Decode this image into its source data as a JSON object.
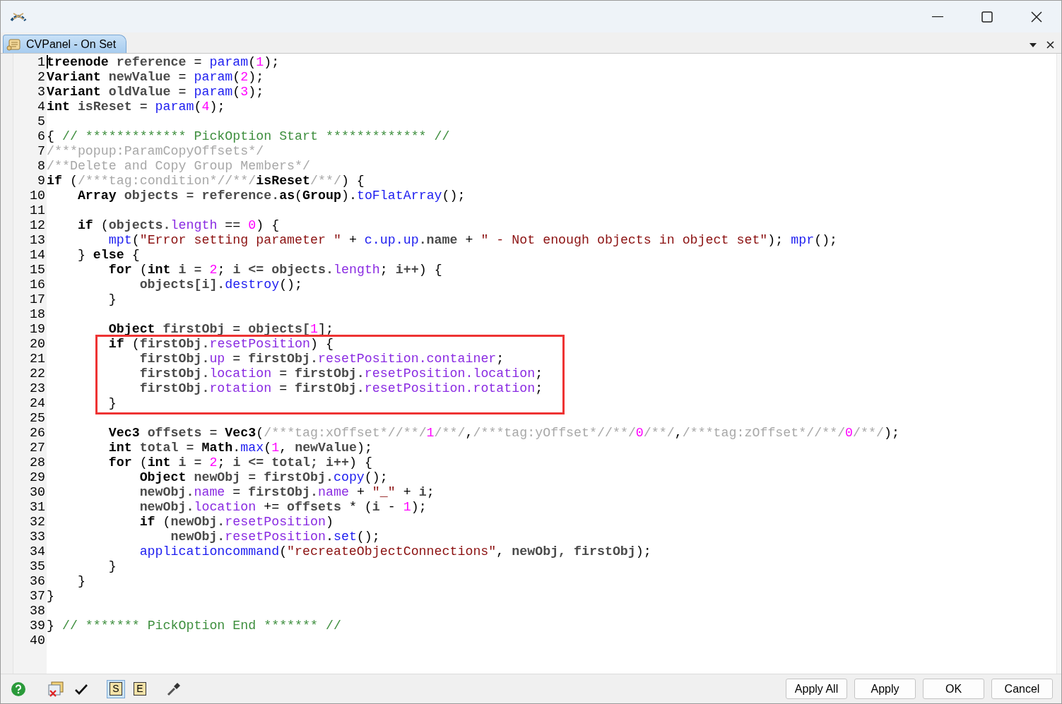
{
  "window": {
    "controls": [
      {
        "kind": "minimize"
      },
      {
        "kind": "maximize"
      },
      {
        "kind": "close"
      }
    ]
  },
  "tabs": [
    {
      "label": "CVPanel - On Set",
      "selected": true
    }
  ],
  "editor": {
    "blocks": [
      {
        "highlighted": false,
        "lines": [
          {
            "number": "1",
            "cursor": true,
            "tokens": [
              {
                "kind": "keyword",
                "text": "treenode"
              },
              {
                "kind": "ident",
                "text": " reference"
              },
              {
                "kind": "punct",
                "text": " = "
              },
              {
                "kind": "func",
                "text": "param"
              },
              {
                "kind": "punct",
                "text": "("
              },
              {
                "kind": "number",
                "text": "1"
              },
              {
                "kind": "punct",
                "text": ");"
              }
            ]
          },
          {
            "number": "2",
            "cursor": false,
            "tokens": [
              {
                "kind": "keyword",
                "text": "Variant"
              },
              {
                "kind": "ident",
                "text": " newValue"
              },
              {
                "kind": "punct",
                "text": " = "
              },
              {
                "kind": "func",
                "text": "param"
              },
              {
                "kind": "punct",
                "text": "("
              },
              {
                "kind": "number",
                "text": "2"
              },
              {
                "kind": "punct",
                "text": ");"
              }
            ]
          },
          {
            "number": "3",
            "cursor": false,
            "tokens": [
              {
                "kind": "keyword",
                "text": "Variant"
              },
              {
                "kind": "ident",
                "text": " oldValue"
              },
              {
                "kind": "punct",
                "text": " = "
              },
              {
                "kind": "func",
                "text": "param"
              },
              {
                "kind": "punct",
                "text": "("
              },
              {
                "kind": "number",
                "text": "3"
              },
              {
                "kind": "punct",
                "text": ");"
              }
            ]
          },
          {
            "number": "4",
            "cursor": false,
            "tokens": [
              {
                "kind": "keyword",
                "text": "int"
              },
              {
                "kind": "ident",
                "text": " isReset"
              },
              {
                "kind": "punct",
                "text": " = "
              },
              {
                "kind": "func",
                "text": "param"
              },
              {
                "kind": "punct",
                "text": "("
              },
              {
                "kind": "number",
                "text": "4"
              },
              {
                "kind": "punct",
                "text": ");"
              }
            ]
          },
          {
            "number": "5",
            "cursor": false
          },
          {
            "number": "6",
            "cursor": false,
            "tokens": [
              {
                "kind": "punct",
                "text": "{ "
              },
              {
                "kind": "comment",
                "text": "// ************* PickOption Start ************* //"
              }
            ]
          },
          {
            "number": "7",
            "cursor": false,
            "tokens": [
              {
                "kind": "tag",
                "text": "/***popup:ParamCopyOffsets*/"
              }
            ]
          },
          {
            "number": "8",
            "cursor": false,
            "tokens": [
              {
                "kind": "tag",
                "text": "/**Delete and Copy Group Members*/"
              }
            ]
          },
          {
            "number": "9",
            "cursor": false,
            "tokens": [
              {
                "kind": "keyword",
                "text": "if"
              },
              {
                "kind": "punct",
                "text": " ("
              },
              {
                "kind": "tag",
                "text": "/***tag:condition*//**/"
              },
              {
                "kind": "keyword",
                "text": "isReset"
              },
              {
                "kind": "tag",
                "text": "/**/"
              },
              {
                "kind": "punct",
                "text": ") {"
              }
            ]
          },
          {
            "number": "10",
            "cursor": false,
            "tokens": [
              {
                "kind": "keyword",
                "text": "    Array"
              },
              {
                "kind": "ident",
                "text": " objects"
              },
              {
                "kind": "punct",
                "text": " = "
              },
              {
                "kind": "ident",
                "text": "reference."
              },
              {
                "kind": "keyword",
                "text": "as"
              },
              {
                "kind": "punct",
                "text": "("
              },
              {
                "kind": "keyword",
                "text": "Group"
              },
              {
                "kind": "punct",
                "text": ")."
              },
              {
                "kind": "func",
                "text": "toFlatArray"
              },
              {
                "kind": "punct",
                "text": "();"
              }
            ]
          },
          {
            "number": "11",
            "cursor": false
          },
          {
            "number": "12",
            "cursor": false,
            "tokens": [
              {
                "kind": "keyword",
                "text": "    if"
              },
              {
                "kind": "punct",
                "text": " ("
              },
              {
                "kind": "ident",
                "text": "objects."
              },
              {
                "kind": "member",
                "text": "length"
              },
              {
                "kind": "punct",
                "text": " == "
              },
              {
                "kind": "number",
                "text": "0"
              },
              {
                "kind": "punct",
                "text": ") {"
              }
            ]
          },
          {
            "number": "13",
            "cursor": false,
            "tokens": [
              {
                "kind": "func",
                "text": "        mpt"
              },
              {
                "kind": "punct",
                "text": "("
              },
              {
                "kind": "string",
                "text": "\"Error setting parameter \""
              },
              {
                "kind": "punct",
                "text": " + "
              },
              {
                "kind": "func",
                "text": "c.up.up"
              },
              {
                "kind": "ident",
                "text": ".name"
              },
              {
                "kind": "punct",
                "text": " + "
              },
              {
                "kind": "string",
                "text": "\" - Not enough objects in object set\""
              },
              {
                "kind": "punct",
                "text": "); "
              },
              {
                "kind": "func",
                "text": "mpr"
              },
              {
                "kind": "punct",
                "text": "();"
              }
            ]
          },
          {
            "number": "14",
            "cursor": false,
            "tokens": [
              {
                "kind": "punct",
                "text": "    } "
              },
              {
                "kind": "keyword",
                "text": "else"
              },
              {
                "kind": "punct",
                "text": " {"
              }
            ]
          },
          {
            "number": "15",
            "cursor": false,
            "tokens": [
              {
                "kind": "keyword",
                "text": "        for"
              },
              {
                "kind": "punct",
                "text": " ("
              },
              {
                "kind": "keyword",
                "text": "int"
              },
              {
                "kind": "ident",
                "text": " i"
              },
              {
                "kind": "punct",
                "text": " = "
              },
              {
                "kind": "number",
                "text": "2"
              },
              {
                "kind": "punct",
                "text": "; "
              },
              {
                "kind": "ident",
                "text": "i <= objects."
              },
              {
                "kind": "member",
                "text": "length"
              },
              {
                "kind": "punct",
                "text": "; "
              },
              {
                "kind": "ident",
                "text": "i++"
              },
              {
                "kind": "punct",
                "text": ") {"
              }
            ]
          },
          {
            "number": "16",
            "cursor": false,
            "tokens": [
              {
                "kind": "ident",
                "text": "            objects[i]."
              },
              {
                "kind": "func",
                "text": "destroy"
              },
              {
                "kind": "punct",
                "text": "();"
              }
            ]
          },
          {
            "number": "17",
            "cursor": false,
            "tokens": [
              {
                "kind": "punct",
                "text": "        }"
              }
            ]
          },
          {
            "number": "18",
            "cursor": false
          },
          {
            "number": "19",
            "cursor": false,
            "tokens": [
              {
                "kind": "keyword",
                "text": "        Object"
              },
              {
                "kind": "ident",
                "text": " firstObj"
              },
              {
                "kind": "punct",
                "text": " = "
              },
              {
                "kind": "ident",
                "text": "objects["
              },
              {
                "kind": "number",
                "text": "1"
              },
              {
                "kind": "punct",
                "text": "];"
              }
            ]
          }
        ]
      },
      {
        "highlighted": true,
        "lines": [
          {
            "number": "20",
            "cursor": false,
            "tokens": [
              {
                "kind": "keyword",
                "text": "        if"
              },
              {
                "kind": "punct",
                "text": " ("
              },
              {
                "kind": "ident",
                "text": "firstObj."
              },
              {
                "kind": "member",
                "text": "resetPosition"
              },
              {
                "kind": "punct",
                "text": ") {"
              }
            ]
          },
          {
            "number": "21",
            "cursor": false,
            "tokens": [
              {
                "kind": "ident",
                "text": "            firstObj."
              },
              {
                "kind": "member",
                "text": "up"
              },
              {
                "kind": "punct",
                "text": " = "
              },
              {
                "kind": "ident",
                "text": "firstObj."
              },
              {
                "kind": "member",
                "text": "resetPosition.container"
              },
              {
                "kind": "punct",
                "text": ";"
              }
            ]
          },
          {
            "number": "22",
            "cursor": false,
            "tokens": [
              {
                "kind": "ident",
                "text": "            firstObj."
              },
              {
                "kind": "member",
                "text": "location"
              },
              {
                "kind": "punct",
                "text": " = "
              },
              {
                "kind": "ident",
                "text": "firstObj."
              },
              {
                "kind": "member",
                "text": "resetPosition.location"
              },
              {
                "kind": "punct",
                "text": ";"
              }
            ]
          },
          {
            "number": "23",
            "cursor": false,
            "tokens": [
              {
                "kind": "ident",
                "text": "            firstObj."
              },
              {
                "kind": "member",
                "text": "rotation"
              },
              {
                "kind": "punct",
                "text": " = "
              },
              {
                "kind": "ident",
                "text": "firstObj."
              },
              {
                "kind": "member",
                "text": "resetPosition.rotation"
              },
              {
                "kind": "punct",
                "text": ";"
              }
            ]
          },
          {
            "number": "24",
            "cursor": false,
            "tokens": [
              {
                "kind": "punct",
                "text": "        }"
              }
            ]
          }
        ]
      },
      {
        "highlighted": false,
        "lines": [
          {
            "number": "25",
            "cursor": false
          },
          {
            "number": "26",
            "cursor": false,
            "tokens": [
              {
                "kind": "keyword",
                "text": "        Vec3"
              },
              {
                "kind": "ident",
                "text": " offsets"
              },
              {
                "kind": "punct",
                "text": " = "
              },
              {
                "kind": "keyword",
                "text": "Vec3"
              },
              {
                "kind": "punct",
                "text": "("
              },
              {
                "kind": "tag",
                "text": "/***tag:xOffset*//**/"
              },
              {
                "kind": "number",
                "text": "1"
              },
              {
                "kind": "tag",
                "text": "/**/"
              },
              {
                "kind": "punct",
                "text": ","
              },
              {
                "kind": "tag",
                "text": "/***tag:yOffset*//**/"
              },
              {
                "kind": "number",
                "text": "0"
              },
              {
                "kind": "tag",
                "text": "/**/"
              },
              {
                "kind": "punct",
                "text": ","
              },
              {
                "kind": "tag",
                "text": "/***tag:zOffset*//**/"
              },
              {
                "kind": "number",
                "text": "0"
              },
              {
                "kind": "tag",
                "text": "/**/"
              },
              {
                "kind": "punct",
                "text": ");"
              }
            ]
          },
          {
            "number": "27",
            "cursor": false,
            "tokens": [
              {
                "kind": "keyword",
                "text": "        int"
              },
              {
                "kind": "ident",
                "text": " total"
              },
              {
                "kind": "punct",
                "text": " = "
              },
              {
                "kind": "keyword",
                "text": "Math"
              },
              {
                "kind": "punct",
                "text": "."
              },
              {
                "kind": "func",
                "text": "max"
              },
              {
                "kind": "punct",
                "text": "("
              },
              {
                "kind": "number",
                "text": "1"
              },
              {
                "kind": "punct",
                "text": ", "
              },
              {
                "kind": "ident",
                "text": "newValue"
              },
              {
                "kind": "punct",
                "text": ");"
              }
            ]
          },
          {
            "number": "28",
            "cursor": false,
            "tokens": [
              {
                "kind": "keyword",
                "text": "        for"
              },
              {
                "kind": "punct",
                "text": " ("
              },
              {
                "kind": "keyword",
                "text": "int"
              },
              {
                "kind": "ident",
                "text": " i"
              },
              {
                "kind": "punct",
                "text": " = "
              },
              {
                "kind": "number",
                "text": "2"
              },
              {
                "kind": "punct",
                "text": "; "
              },
              {
                "kind": "ident",
                "text": "i <= total; i++"
              },
              {
                "kind": "punct",
                "text": ") {"
              }
            ]
          },
          {
            "number": "29",
            "cursor": false,
            "tokens": [
              {
                "kind": "keyword",
                "text": "            Object"
              },
              {
                "kind": "ident",
                "text": " newObj"
              },
              {
                "kind": "punct",
                "text": " = "
              },
              {
                "kind": "ident",
                "text": "firstObj."
              },
              {
                "kind": "func",
                "text": "copy"
              },
              {
                "kind": "punct",
                "text": "();"
              }
            ]
          },
          {
            "number": "30",
            "cursor": false,
            "tokens": [
              {
                "kind": "ident",
                "text": "            newObj."
              },
              {
                "kind": "member",
                "text": "name"
              },
              {
                "kind": "punct",
                "text": " = "
              },
              {
                "kind": "ident",
                "text": "firstObj."
              },
              {
                "kind": "member",
                "text": "name"
              },
              {
                "kind": "punct",
                "text": " + "
              },
              {
                "kind": "string",
                "text": "\"_\""
              },
              {
                "kind": "punct",
                "text": " + "
              },
              {
                "kind": "ident",
                "text": "i"
              },
              {
                "kind": "punct",
                "text": ";"
              }
            ]
          },
          {
            "number": "31",
            "cursor": false,
            "tokens": [
              {
                "kind": "ident",
                "text": "            newObj."
              },
              {
                "kind": "member",
                "text": "location"
              },
              {
                "kind": "punct",
                "text": " += "
              },
              {
                "kind": "ident",
                "text": "offsets"
              },
              {
                "kind": "punct",
                "text": " * ("
              },
              {
                "kind": "ident",
                "text": "i"
              },
              {
                "kind": "punct",
                "text": " - "
              },
              {
                "kind": "number",
                "text": "1"
              },
              {
                "kind": "punct",
                "text": ");"
              }
            ]
          },
          {
            "number": "32",
            "cursor": false,
            "tokens": [
              {
                "kind": "keyword",
                "text": "            if"
              },
              {
                "kind": "punct",
                "text": " ("
              },
              {
                "kind": "ident",
                "text": "newObj."
              },
              {
                "kind": "member",
                "text": "resetPosition"
              },
              {
                "kind": "punct",
                "text": ")"
              }
            ]
          },
          {
            "number": "33",
            "cursor": false,
            "tokens": [
              {
                "kind": "ident",
                "text": "                newObj."
              },
              {
                "kind": "member",
                "text": "resetPosition"
              },
              {
                "kind": "punct",
                "text": "."
              },
              {
                "kind": "func",
                "text": "set"
              },
              {
                "kind": "punct",
                "text": "();"
              }
            ]
          },
          {
            "number": "34",
            "cursor": false,
            "tokens": [
              {
                "kind": "func",
                "text": "            applicationcommand"
              },
              {
                "kind": "punct",
                "text": "("
              },
              {
                "kind": "string",
                "text": "\"recreateObjectConnections\""
              },
              {
                "kind": "punct",
                "text": ", "
              },
              {
                "kind": "ident",
                "text": "newObj, firstObj"
              },
              {
                "kind": "punct",
                "text": ");"
              }
            ]
          },
          {
            "number": "35",
            "cursor": false,
            "tokens": [
              {
                "kind": "punct",
                "text": "        }"
              }
            ]
          },
          {
            "number": "36",
            "cursor": false,
            "tokens": [
              {
                "kind": "punct",
                "text": "    }"
              }
            ]
          },
          {
            "number": "37",
            "cursor": false,
            "tokens": [
              {
                "kind": "punct",
                "text": "}"
              }
            ]
          },
          {
            "number": "38",
            "cursor": false
          },
          {
            "number": "39",
            "cursor": false,
            "tokens": [
              {
                "kind": "punct",
                "text": "} "
              },
              {
                "kind": "comment",
                "text": "// ******* PickOption End ******* //"
              }
            ]
          },
          {
            "number": "40",
            "cursor": false
          }
        ]
      }
    ]
  },
  "toolbar": {
    "tools": [
      {
        "kind": "help"
      },
      {
        "kind": "sheet"
      },
      {
        "kind": "check"
      },
      {
        "kind": "letter",
        "label": "S",
        "selected": true
      },
      {
        "kind": "letter",
        "label": "E",
        "selected": false
      },
      {
        "kind": "picker"
      }
    ],
    "buttons": [
      "Apply All",
      "Apply",
      "OK",
      "Cancel"
    ]
  }
}
